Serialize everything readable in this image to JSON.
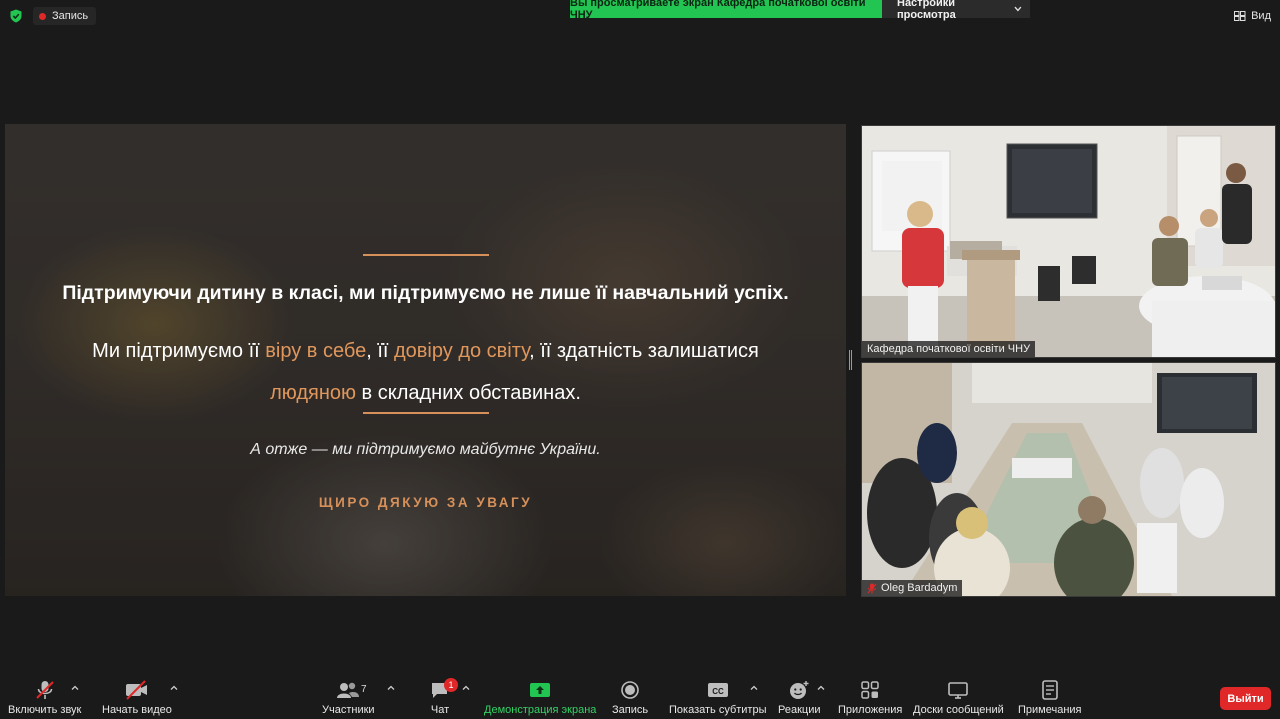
{
  "top": {
    "recording_label": "Запись",
    "share_banner": "Вы просматриваете экран Кафедра початкової освіти ЧНУ",
    "view_options": "Настройки просмотра",
    "view_button": "Вид"
  },
  "slide": {
    "line1": "Підтримуючи дитину в класі, ми підтримуємо не лише її навчальний успіх.",
    "line2_a": "Ми підтримуємо її ",
    "line2_hl1": "віру в себе",
    "line2_b": ", її ",
    "line2_hl2": "довіру до світу",
    "line2_c": ", її здатність залишатися",
    "line3_hl": "людяною",
    "line3_b": " в складних обставинах.",
    "quote": "А отже — ми підтримуємо майбутнє України.",
    "thanks": "ЩИРО ДЯКУЮ ЗА УВАГУ",
    "accent_color": "#d6905a"
  },
  "tiles": [
    {
      "name": "Кафедра початкової освіти ЧНУ",
      "muted": false
    },
    {
      "name": "Oleg Bardadym",
      "muted": true
    }
  ],
  "toolbar": {
    "audio": "Включить звук",
    "video": "Начать видео",
    "participants": "Участники",
    "participants_count": "7",
    "chat": "Чат",
    "chat_badge": "1",
    "share": "Демонстрация экрана",
    "record": "Запись",
    "captions": "Показать субтитры",
    "captions_icon_text": "CC",
    "reactions": "Реакции",
    "apps": "Приложения",
    "whiteboards": "Доски сообщений",
    "notes": "Примечания",
    "leave": "Выйти"
  }
}
